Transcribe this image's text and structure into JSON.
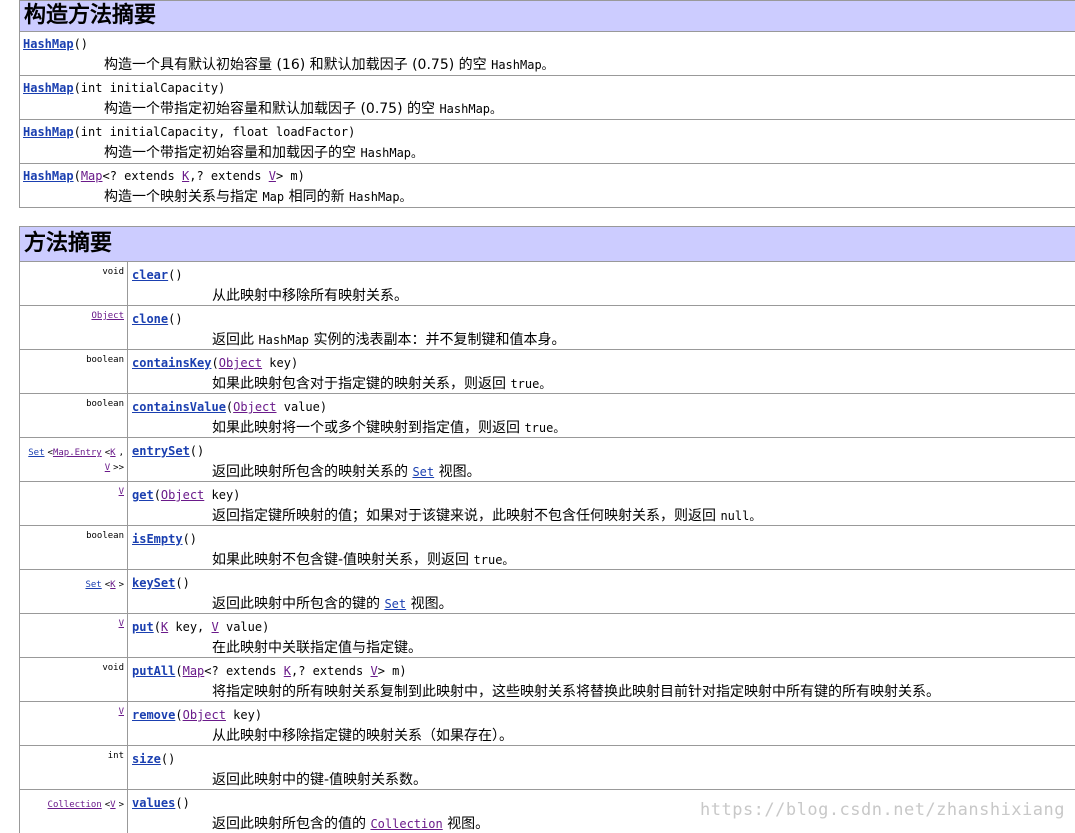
{
  "constructor_summary": {
    "title": "构造方法摘要",
    "rows": [
      {
        "name": "HashMap",
        "params": "()",
        "desc": "构造一个具有默认初始容量 (16) 和默认加载因子 (0.75) 的空",
        "desc_code": "HashMap。"
      },
      {
        "name": "HashMap",
        "params": "(int initialCapacity)",
        "desc": "构造一个带指定初始容量和默认加载因子 (0.75) 的空",
        "desc_code": "HashMap。"
      },
      {
        "name": "HashMap",
        "params": "(int initialCapacity, float loadFactor)",
        "desc": "构造一个带指定初始容量和加载因子的空",
        "desc_code": "HashMap。"
      },
      {
        "name": "HashMap",
        "params_pre": "(",
        "map": "Map",
        "mid1": "<? extends ",
        "k": "K",
        "mid2": ",? extends ",
        "v": "V",
        "post": "> m)",
        "desc": "构造一个映射关系与指定",
        "desc_code": "Map",
        "desc2": "相同的新",
        "desc_code2": "HashMap。"
      }
    ]
  },
  "method_summary": {
    "title": "方法摘要",
    "rows": [
      {
        "ret": "void",
        "name": "clear",
        "params": "()",
        "desc": "从此映射中移除所有映射关系。"
      },
      {
        "ret": "Object",
        "name": "clone",
        "params": "()",
        "desc_pre": "返回此",
        "desc_code": "HashMap",
        "desc": "实例的浅表副本：并不复制键和值本身。"
      },
      {
        "ret": "boolean",
        "name": "containsKey",
        "p_type": "Object",
        "p_name": " key)",
        "desc": "如果此映射包含对于指定键的映射关系，则返回",
        "desc_code": "true。"
      },
      {
        "ret": "boolean",
        "name": "containsValue",
        "p_type": "Object",
        "p_name": " value)",
        "desc": "如果此映射将一个或多个键映射到指定值，则返回",
        "desc_code": "true。"
      },
      {
        "ret_set": "Set",
        "ret_entry": "Map.Entry",
        "ret_k": "K",
        "ret_v": "V",
        "name": "entrySet",
        "params": "()",
        "desc": "返回此映射所包含的映射关系的",
        "desc_link": "Set",
        "desc2": "视图。"
      },
      {
        "ret": "V",
        "name": "get",
        "p_type": "Object",
        "p_name": " key)",
        "desc": "返回指定键所映射的值；如果对于该键来说，此映射不包含任何映射关系，则返回",
        "desc_code": "null。"
      },
      {
        "ret": "boolean",
        "name": "isEmpty",
        "params": "()",
        "desc": "如果此映射不包含键-值映射关系，则返回",
        "desc_code": "true。"
      },
      {
        "ret_set": "Set",
        "ret_k": "K",
        "name": "keySet",
        "params": "()",
        "desc": "返回此映射中所包含的键的",
        "desc_link": "Set",
        "desc2": "视图。"
      },
      {
        "ret": "V",
        "name": "put",
        "k": "K",
        "k_name": " key, ",
        "v": "V",
        "v_name": " value)",
        "desc": "在此映射中关联指定值与指定键。"
      },
      {
        "ret": "void",
        "name": "putAll",
        "map": "Map",
        "mid1": "<? extends ",
        "k": "K",
        "mid2": ",? extends ",
        "v": "V",
        "post": "> m)",
        "desc": "将指定映射的所有映射关系复制到此映射中，这些映射关系将替换此映射目前针对指定映射中所有键的所有映射关系。"
      },
      {
        "ret": "V",
        "name": "remove",
        "p_type": "Object",
        "p_name": " key)",
        "desc": "从此映射中移除指定键的映射关系（如果存在）。"
      },
      {
        "ret": "int",
        "name": "size",
        "params": "()",
        "desc": "返回此映射中的键-值映射关系数。"
      },
      {
        "ret_coll": "Collection",
        "ret_v": "V",
        "name": "values",
        "params": "()",
        "desc": "返回此映射所包含的值的",
        "desc_link": "Collection",
        "desc2": "视图。"
      }
    ]
  },
  "watermark": "https://blog.csdn.net/zhanshixiang"
}
